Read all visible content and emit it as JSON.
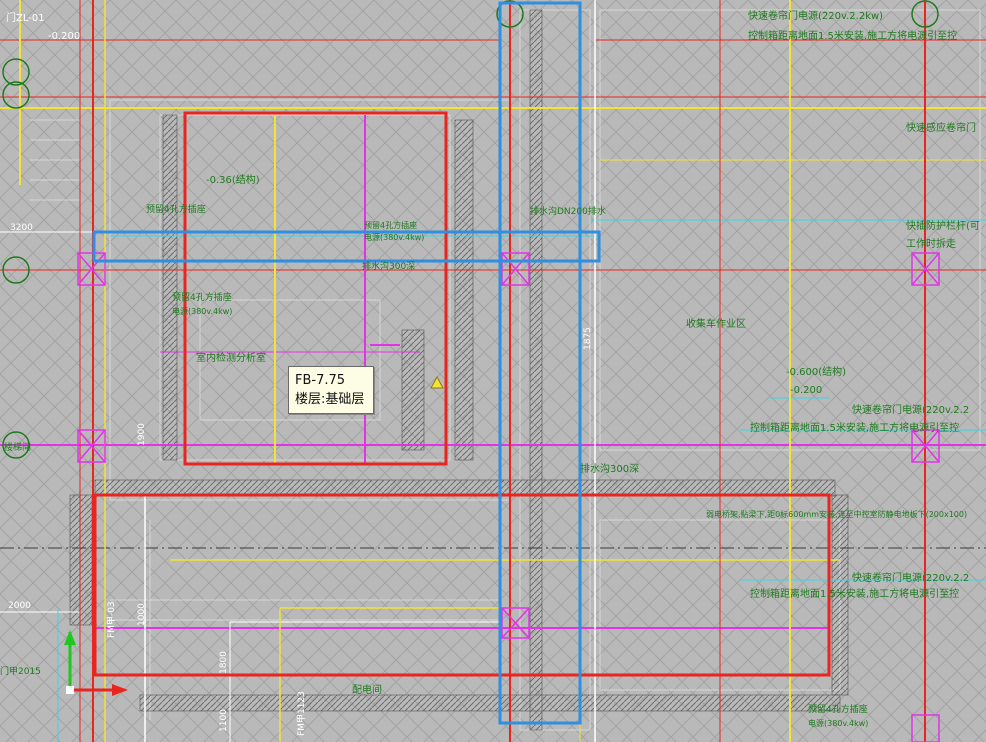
{
  "tooltip": {
    "element_id": "FB-7.75",
    "floor_text": "楼层:基础层"
  },
  "labels": {
    "grid_top_left": "门ZL-01",
    "elev_top_left": "-0.200",
    "dim_3200": "3200",
    "dim_2000": "2000",
    "door_bottom_left": "门甲2015",
    "room_left": "楼梯间",
    "power_top_1": "快速卷帘门电源(220v.2.2kw)",
    "power_top_2": "控制箱距离地面1.5米安装,施工方将电源引至控",
    "power_sense": "快速感应卷帘门",
    "rail_1": "快插防护栏杆(可",
    "rail_2": "工作时拆走",
    "collect_area": "收集车作业区",
    "elev_1": "-0.600(结构)",
    "elev_2": "-0.200",
    "power_mid_1": "快速卷帘门电源(220v.2.2",
    "power_mid_2": "控制箱距离地面1.5米安装,施工方将电源引至控",
    "drain_1": "排水沟300深",
    "drain_2": "排水沟300深",
    "drain_3": "排水沟DN200排水",
    "socket_1": "预留4孔方插座",
    "socket_2": "电源(380v.4kw)",
    "socket_3": "预留4孔方插座",
    "socket_4": "电源(380v.4kw)",
    "indoor_room": "室内检测分析室",
    "elev_mid": "-0.36(结构)",
    "long_note": "弱电桥架,贴梁下,距0标600mm安装,连至中控室防静电地板下(200x100)",
    "power_bot_1": "快速卷帘门电源(220v.2.2",
    "power_bot_2": "控制箱距离地面1.5米安装,施工方将电源引至控",
    "power_room": "配电间",
    "socket_bot_1": "预留4孔方插座",
    "socket_bot_2": "电源(380v.4kw)",
    "dim_1875": "1875",
    "dim_1900": "1900",
    "dim_1000": "1000",
    "dim_1800": "1800",
    "dim_1100": "1100",
    "door_fm1": "FM甲-03",
    "door_fm2": "FM甲1123"
  },
  "colors": {
    "background": "#b9b9b9",
    "hatch": "#a3a3a3",
    "red": "#e8251f",
    "yellow": "#f2e23a",
    "magenta": "#e233e8",
    "cyan": "#39d6e8",
    "white": "#ffffff",
    "green": "#1f7a1f",
    "highlight_red": "#e8251f",
    "highlight_blue": "#2f8fe0",
    "tooltip_bg": "#fdfde6"
  }
}
